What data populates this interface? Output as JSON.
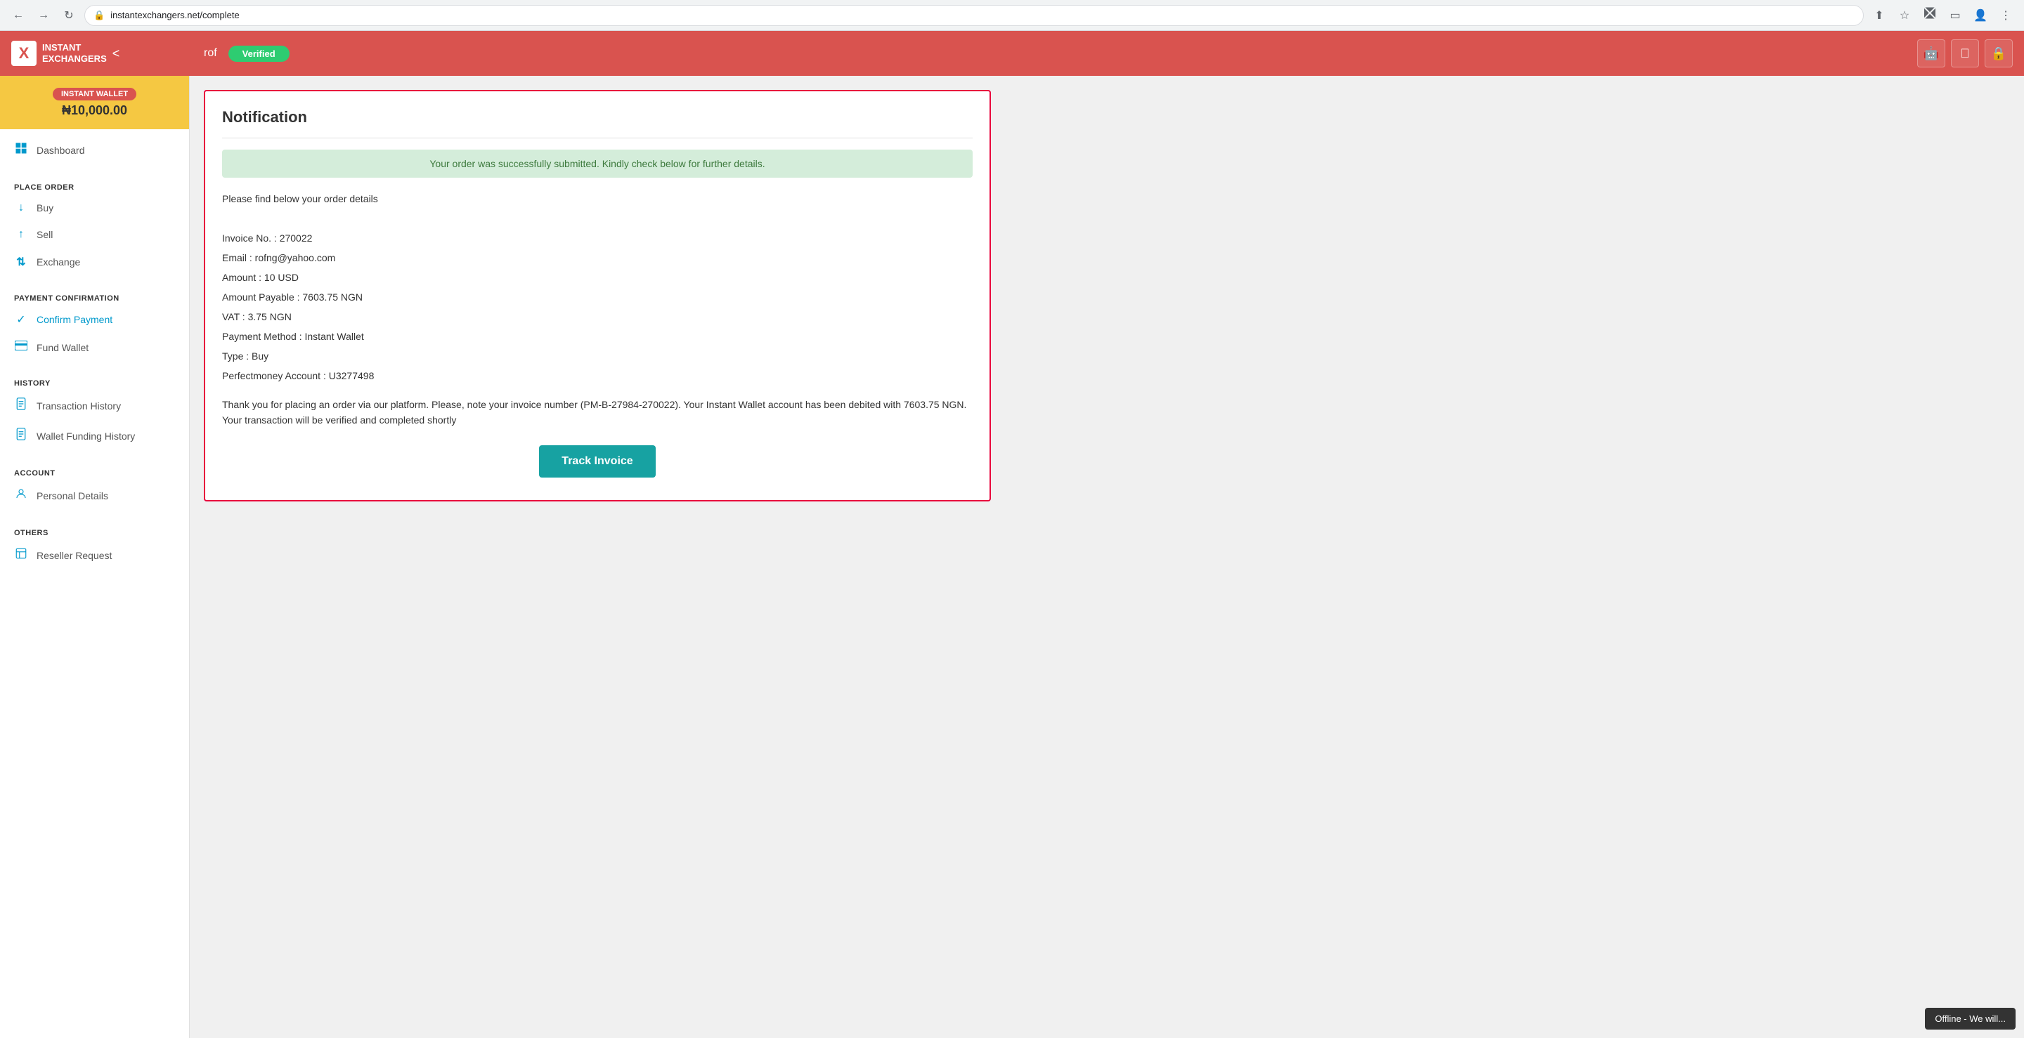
{
  "browser": {
    "url": "instantexchangers.net/complete",
    "lock_icon": "🔒"
  },
  "header": {
    "logo_x": "X",
    "logo_name_line1": "INSTANT",
    "logo_name_line2": "EXCHANGERS",
    "username": "rof",
    "verified_label": "Verified",
    "collapse_icon": "<",
    "android_icon": "🤖",
    "apple_icon": "",
    "lock_icon": "🔒"
  },
  "sidebar": {
    "wallet_label": "INSTANT WALLET",
    "wallet_amount": "₦10,000.00",
    "nav_items": [
      {
        "id": "dashboard",
        "label": "Dashboard",
        "icon": "⊞",
        "section": null
      },
      {
        "id": "buy",
        "label": "Buy",
        "icon": "↓",
        "section": "PLACE ORDER"
      },
      {
        "id": "sell",
        "label": "Sell",
        "icon": "↑",
        "section": null
      },
      {
        "id": "exchange",
        "label": "Exchange",
        "icon": "⇅",
        "section": null
      },
      {
        "id": "confirm-payment",
        "label": "Confirm Payment",
        "icon": "✓",
        "section": "PAYMENT CONFIRMATION"
      },
      {
        "id": "fund-wallet",
        "label": "Fund Wallet",
        "icon": "💳",
        "section": null
      },
      {
        "id": "transaction-history",
        "label": "Transaction History",
        "icon": "📄",
        "section": "HISTORY"
      },
      {
        "id": "wallet-funding-history",
        "label": "Wallet Funding History",
        "icon": "📋",
        "section": null
      },
      {
        "id": "personal-details",
        "label": "Personal Details",
        "icon": "👤",
        "section": "ACCOUNT"
      },
      {
        "id": "reseller-request",
        "label": "Reseller Request",
        "icon": "📘",
        "section": "OTHERS"
      }
    ]
  },
  "content": {
    "notification_title": "Notification",
    "success_message": "Your order was successfully submitted. Kindly check below for further details.",
    "order_intro": "Please find below your order details",
    "invoice_no": "Invoice No. : 270022",
    "email": "Email : rofng@yahoo.com",
    "amount": "Amount : 10 USD",
    "amount_payable": "Amount Payable : 7603.75 NGN",
    "vat": "VAT : 3.75 NGN",
    "payment_method": "Payment Method : Instant Wallet",
    "type": "Type : Buy",
    "perfectmoney_account": "Perfectmoney Account : U3277498",
    "thank_you_text": "Thank you for placing an order via our platform. Please, note your invoice number (PM-B-27984-270022). Your Instant Wallet account has been debited with 7603.75 NGN. Your transaction will be verified and completed shortly",
    "track_invoice_btn": "Track Invoice"
  },
  "offline_badge": "Offline - We will..."
}
